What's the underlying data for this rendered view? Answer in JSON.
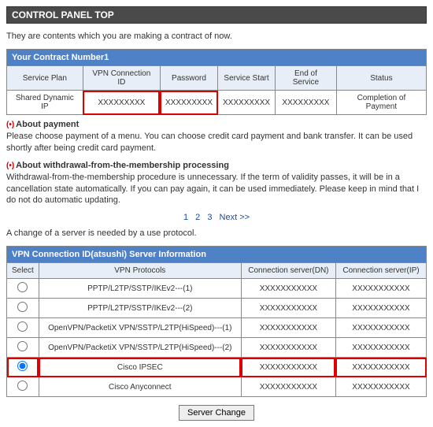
{
  "title": "CONTROL PANEL TOP",
  "intro": "They are contents which you are making a contract of now.",
  "contract": {
    "header": "Your Contract Number1",
    "cols": [
      "Service Plan",
      "VPN Connection ID",
      "Password",
      "Service Start",
      "End of Service",
      "Status"
    ],
    "row": {
      "plan": "Shared Dynamic IP",
      "vpnid": "XXXXXXXXX",
      "password": "XXXXXXXXX",
      "start": "XXXXXXXXX",
      "end": "XXXXXXXXX",
      "status": "Completion of Payment"
    }
  },
  "notes": {
    "payment_head": "About payment",
    "payment_body": "Please choose payment of a menu. You can choose credit card payment and bank transfer. It can be used shortly after being credit card payment.",
    "withdraw_head": "About withdrawal-from-the-membership processing",
    "withdraw_body": "Withdrawal-from-the-membership procedure is unnecessary. If the term of validity passes, it will be in a cancellation state automatically. If you can pay again, it can be used immediately. Please keep in mind that I do not do automatic updating."
  },
  "pager": {
    "p1": "1",
    "p2": "2",
    "p3": "3",
    "next": "Next >>"
  },
  "protocol_note": "A change of a server is needed by a use protocol.",
  "server": {
    "header": "VPN Connection ID(atsushi) Server Information",
    "cols": [
      "Select",
      "VPN Protocols",
      "Connection server(DN)",
      "Connection server(IP)"
    ],
    "rows": [
      {
        "proto": "PPTP/L2TP/SSTP/IKEv2---(1)",
        "dn": "XXXXXXXXXXX",
        "ip": "XXXXXXXXXXX",
        "selected": false,
        "hl": false
      },
      {
        "proto": "PPTP/L2TP/SSTP/IKEv2---(2)",
        "dn": "XXXXXXXXXXX",
        "ip": "XXXXXXXXXXX",
        "selected": false,
        "hl": false
      },
      {
        "proto": "OpenVPN/PacketiX VPN/SSTP/L2TP(HiSpeed)---(1)",
        "dn": "XXXXXXXXXXX",
        "ip": "XXXXXXXXXXX",
        "selected": false,
        "hl": false
      },
      {
        "proto": "OpenVPN/PacketiX VPN/SSTP/L2TP(HiSpeed)---(2)",
        "dn": "XXXXXXXXXXX",
        "ip": "XXXXXXXXXXX",
        "selected": false,
        "hl": false
      },
      {
        "proto": "Cisco IPSEC",
        "dn": "XXXXXXXXXXX",
        "ip": "XXXXXXXXXXX",
        "selected": true,
        "hl": true
      },
      {
        "proto": "Cisco Anyconnect",
        "dn": "XXXXXXXXXXX",
        "ip": "XXXXXXXXXXX",
        "selected": false,
        "hl": false
      }
    ]
  },
  "button": "Server Change"
}
